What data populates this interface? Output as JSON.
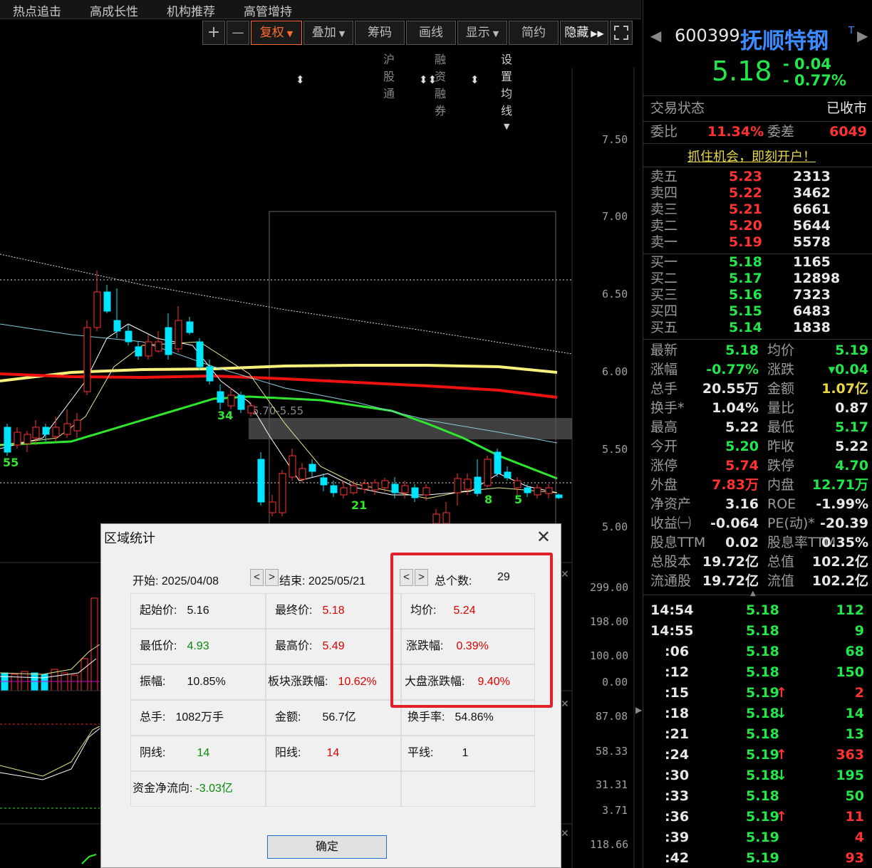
{
  "top_menu": [
    "热点追击",
    "高成长性",
    "机构推荐",
    "高管增持"
  ],
  "toolbar": {
    "plus": "+",
    "minus": "—",
    "fuquan": "复权",
    "diejia": "叠加",
    "chouma": "筹码",
    "huaxian": "画线",
    "xianshi": "显示",
    "jianyue": "简约",
    "yincang": "隐藏"
  },
  "subbar": {
    "hgt": "沪股通",
    "rzrq": "融资融券",
    "ma": "设置均线"
  },
  "chart": {
    "price_ticks": [
      "7.50",
      "7.00",
      "6.50",
      "6.00",
      "5.50",
      "5.00"
    ],
    "vol_ticks": [
      "299.00",
      "198.00",
      "100.00",
      "0.00"
    ],
    "ind_ticks": [
      "87.08",
      "58.33",
      "31.31",
      "3.71"
    ],
    "bottom_tick": "118.66",
    "zone_label": "5.70-5.55",
    "markers": [
      "55",
      "34",
      "21",
      "8",
      "5"
    ]
  },
  "stock": {
    "code": "600399",
    "name": "抚顺特钢",
    "price": "5.18",
    "change": "- 0.04",
    "change_pct": "- 0.77%",
    "t_badge": "T"
  },
  "status": {
    "label": "交易状态",
    "value": "已收市"
  },
  "weibi": {
    "label1": "委比",
    "value1": "11.34%",
    "label2": "委差",
    "value2": "6049"
  },
  "ad_link": "抓住机会，即刻开户！",
  "asks": [
    {
      "label": "卖五",
      "price": "5.23",
      "vol": "2313"
    },
    {
      "label": "卖四",
      "price": "5.22",
      "vol": "3462"
    },
    {
      "label": "卖三",
      "price": "5.21",
      "vol": "6661"
    },
    {
      "label": "卖二",
      "price": "5.20",
      "vol": "5644"
    },
    {
      "label": "卖一",
      "price": "5.19",
      "vol": "5578"
    }
  ],
  "bids": [
    {
      "label": "买一",
      "price": "5.18",
      "vol": "1165"
    },
    {
      "label": "买二",
      "price": "5.17",
      "vol": "12898"
    },
    {
      "label": "买三",
      "price": "5.16",
      "vol": "7323"
    },
    {
      "label": "买四",
      "price": "5.15",
      "vol": "6483"
    },
    {
      "label": "买五",
      "price": "5.14",
      "vol": "1838"
    }
  ],
  "quote": [
    {
      "l1": "最新",
      "v1": "5.18",
      "c1": "green",
      "l2": "均价",
      "v2": "5.19",
      "c2": "green"
    },
    {
      "l1": "涨幅",
      "v1": "-0.77%",
      "c1": "green",
      "l2": "涨跌",
      "v2": "▾0.04",
      "c2": "green"
    },
    {
      "l1": "总手",
      "v1": "20.55万",
      "c1": "white",
      "l2": "金额",
      "v2": "1.07亿",
      "c2": "yellow"
    },
    {
      "l1": "换手*",
      "v1": "1.04%",
      "c1": "white",
      "l2": "量比",
      "v2": "0.87",
      "c2": "white"
    },
    {
      "l1": "最高",
      "v1": "5.22",
      "c1": "white",
      "l2": "最低",
      "v2": "5.17",
      "c2": "green"
    },
    {
      "l1": "今开",
      "v1": "5.20",
      "c1": "green",
      "l2": "昨收",
      "v2": "5.22",
      "c2": "white"
    },
    {
      "l1": "涨停",
      "v1": "5.74",
      "c1": "red",
      "l2": "跌停",
      "v2": "4.70",
      "c2": "green"
    },
    {
      "l1": "外盘",
      "v1": "7.83万",
      "c1": "red",
      "l2": "内盘",
      "v2": "12.71万",
      "c2": "green"
    },
    {
      "l1": "净资产",
      "v1": "3.16",
      "c1": "white",
      "l2": "ROE",
      "v2": "-1.99%",
      "c2": "white"
    },
    {
      "l1": "收益㈠",
      "v1": "-0.064",
      "c1": "white",
      "l2": "PE(动)*",
      "v2": "-20.39",
      "c2": "white"
    },
    {
      "l1": "股息TTM",
      "v1": "0.02",
      "c1": "white",
      "l2": "股息率TTM",
      "v2": "0.35%",
      "c2": "white"
    },
    {
      "l1": "总股本",
      "v1": "19.72亿",
      "c1": "white",
      "l2": "总值",
      "v2": "102.2亿",
      "c2": "white"
    },
    {
      "l1": "流通股",
      "v1": "19.72亿",
      "c1": "white",
      "l2": "流值",
      "v2": "102.2亿",
      "c2": "white"
    }
  ],
  "ticks": [
    {
      "t": "14:54",
      "p": "5.18",
      "a": "",
      "v": "112",
      "pc": "green",
      "vc": "green"
    },
    {
      "t": "14:55",
      "p": "5.18",
      "a": "",
      "v": "9",
      "pc": "green",
      "vc": "green"
    },
    {
      "t": ":06",
      "p": "5.18",
      "a": "",
      "v": "68",
      "pc": "green",
      "vc": "green"
    },
    {
      "t": ":12",
      "p": "5.18",
      "a": "",
      "v": "150",
      "pc": "green",
      "vc": "green"
    },
    {
      "t": ":15",
      "p": "5.19",
      "a": "↑",
      "v": "2",
      "pc": "green",
      "vc": "red"
    },
    {
      "t": ":18",
      "p": "5.18",
      "a": "↓",
      "v": "14",
      "pc": "green",
      "vc": "green"
    },
    {
      "t": ":21",
      "p": "5.18",
      "a": "",
      "v": "13",
      "pc": "green",
      "vc": "green"
    },
    {
      "t": ":24",
      "p": "5.19",
      "a": "↑",
      "v": "363",
      "pc": "green",
      "vc": "red"
    },
    {
      "t": ":30",
      "p": "5.18",
      "a": "↓",
      "v": "195",
      "pc": "green",
      "vc": "green"
    },
    {
      "t": ":33",
      "p": "5.18",
      "a": "",
      "v": "50",
      "pc": "green",
      "vc": "green"
    },
    {
      "t": ":36",
      "p": "5.19",
      "a": "↑",
      "v": "11",
      "pc": "green",
      "vc": "red"
    },
    {
      "t": ":39",
      "p": "5.19",
      "a": "",
      "v": "4",
      "pc": "green",
      "vc": "red"
    },
    {
      "t": ":42",
      "p": "5.19",
      "a": "",
      "v": "93",
      "pc": "green",
      "vc": "red"
    }
  ],
  "dialog": {
    "title": "区域统计",
    "start_label": "开始:",
    "start_value": "2025/04/08",
    "end_label": "结束:",
    "end_value": "2025/05/21",
    "count_label": "总个数:",
    "count_value": "29",
    "nav_prev": "<",
    "nav_next": ">",
    "open_label": "起始价:",
    "open_value": "5.16",
    "close_label": "最终价:",
    "close_value": "5.18",
    "avg_label": "均价:",
    "avg_value": "5.24",
    "low_label": "最低价:",
    "low_value": "4.93",
    "high_label": "最高价:",
    "high_value": "5.49",
    "chg_label": "涨跌幅:",
    "chg_value": "0.39%",
    "amp_label": "振幅:",
    "amp_value": "10.85%",
    "sector_label": "板块涨跌幅:",
    "sector_value": "10.62%",
    "market_label": "大盘涨跌幅:",
    "market_value": "9.40%",
    "vol_label": "总手:",
    "vol_value": "1082万手",
    "amt_label": "金额:",
    "amt_value": "56.7亿",
    "turn_label": "换手率:",
    "turn_value": "54.86%",
    "yin_label": "阴线:",
    "yin_value": "14",
    "yang_label": "阳线:",
    "yang_value": "14",
    "flat_label": "平线:",
    "flat_value": "1",
    "flow_label": "资金净流向:",
    "flow_value": "-3.03亿",
    "ok": "确定"
  },
  "colors": {
    "up": "#ff3333",
    "down": "#00e5ff",
    "accent": "#ff6a2e",
    "highlight": "#e0202a"
  }
}
